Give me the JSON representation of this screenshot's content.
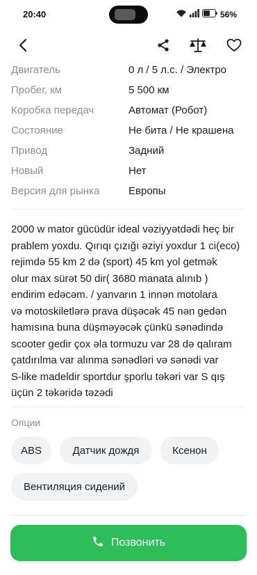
{
  "status_bar": {
    "time": "20:40",
    "battery": "56%",
    "icons": [
      "wifi-icon",
      "signal-icon",
      "battery-icon"
    ]
  },
  "toolbar": {
    "icons": [
      "back-arrow-icon",
      "share-icon",
      "compare-scales-icon",
      "favorite-heart-icon"
    ]
  },
  "specs": [
    {
      "label": "Двигатель",
      "value": "0 л / 5 л.с. / Электро"
    },
    {
      "label": "Пробег, км",
      "value": "5 500 км"
    },
    {
      "label": "Коробка передач",
      "value": "Автомат (Робот)"
    },
    {
      "label": "Состояние",
      "value": "Не бита / Не крашена"
    },
    {
      "label": "Привод",
      "value": "Задний"
    },
    {
      "label": "Новый",
      "value": "Нет"
    },
    {
      "label": "Версия для рынка",
      "value": "Европы"
    }
  ],
  "description": [
    "2000 w mator gücüdür ideal vəziyyətdədi heç bir",
    "prablem yoxdu. Qırıqı çızığı əziyi yoxdur 1 ci(eco)",
    "rejimdə 55 km 2 də (sport) 45 km yol getmək",
    "olur max sürət 50 dir( 3680 manata alınıb )",
    "endirim edəcəm. / yanvarın 1 innən motolara",
    "və motoskiletlərə prava düşəcək 45 nən gedən",
    "hamısına buna düşməyəcək çünkü sənədində",
    "scooter gedir çox əla tormuzu var 28 də qalıram",
    "çatdırılma var alınma sənədləri və sənədi var",
    "S-like  madeldir  sportdur şporlu təkəri var S qış",
    "üçün 2 təkəridə təzədi"
  ],
  "options": {
    "title": "Опции",
    "chips": [
      "ABS",
      "Датчик дождя",
      "Ксенон",
      "Вентиляция сидений"
    ]
  },
  "call_button": {
    "label": "Позвонить",
    "color": "#2ebd59"
  }
}
